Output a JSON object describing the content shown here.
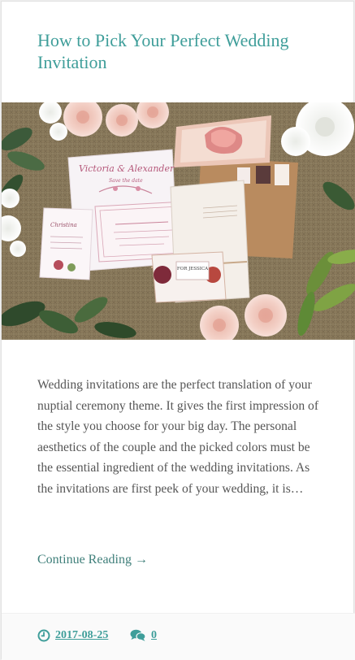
{
  "post": {
    "title": "How to Pick Your Perfect Wedding Invitation",
    "image": {
      "alt": "Wedding invitation suite with floral designs",
      "card_name": "Victoria & Alexander",
      "card_tagline": "Save the date",
      "place_card": "FOR JESSICA",
      "small_card": "Christina"
    },
    "excerpt": "Wedding invitations are the perfect translation of your nuptial ceremony theme. It gives the first impression of the style you choose for your big day. The personal aesthetics of the couple and the picked colors must be the essential ingredient of the wedding invitations. As the invitations are first peek of your wedding, it is…",
    "continue_label": "Continue Reading",
    "continue_arrow": "→",
    "date": "2017-08-25",
    "comment_count": "0"
  },
  "icons": {
    "date": "clock-icon",
    "comments": "comments-icon"
  },
  "colors": {
    "title": "#3f9e9a",
    "link": "#3f7f7a",
    "text": "#555555",
    "footer_bg": "#fafafa"
  }
}
